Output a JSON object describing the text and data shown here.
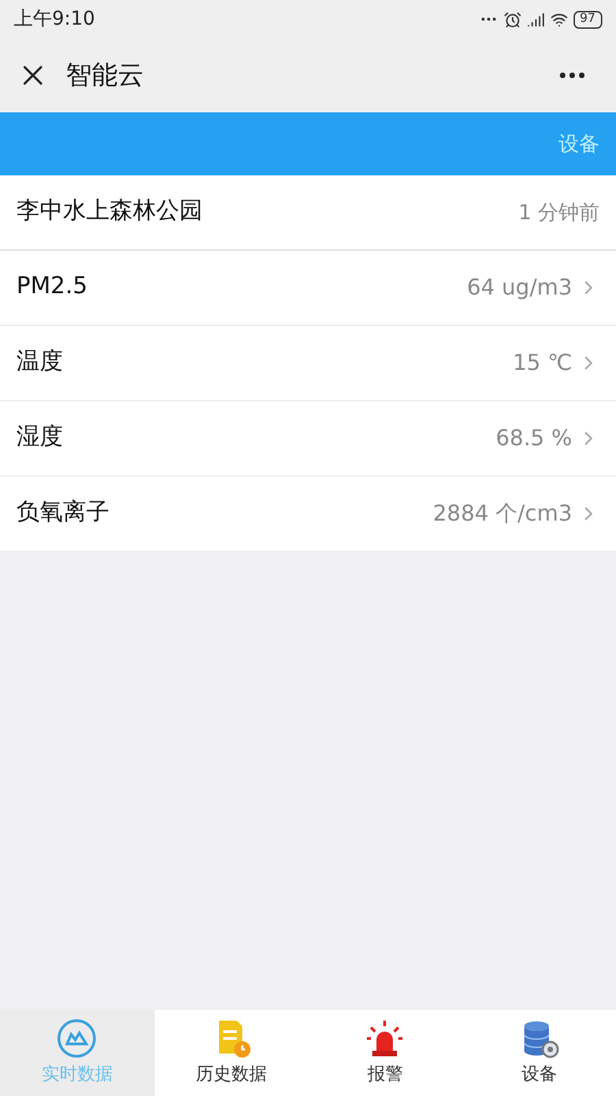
{
  "status_bar": {
    "time": "上午9:10",
    "battery": "97"
  },
  "header": {
    "title": "智能云"
  },
  "blue_bar": {
    "link": "设备"
  },
  "site": {
    "name": "李中水上森林公园",
    "updated": "1 分钟前"
  },
  "readings": [
    {
      "label": "PM2.5",
      "value": "64 ug/m3"
    },
    {
      "label": "温度",
      "value": "15 ℃"
    },
    {
      "label": "湿度",
      "value": "68.5 %"
    },
    {
      "label": "负氧离子",
      "value": "2884 个/cm3"
    }
  ],
  "tabs": [
    {
      "kind": "realtime",
      "label": "实时数据",
      "selected": true
    },
    {
      "kind": "history",
      "label": "历史数据",
      "selected": false
    },
    {
      "kind": "alarm",
      "label": "报警",
      "selected": false
    },
    {
      "kind": "device",
      "label": "设备",
      "selected": false
    }
  ]
}
